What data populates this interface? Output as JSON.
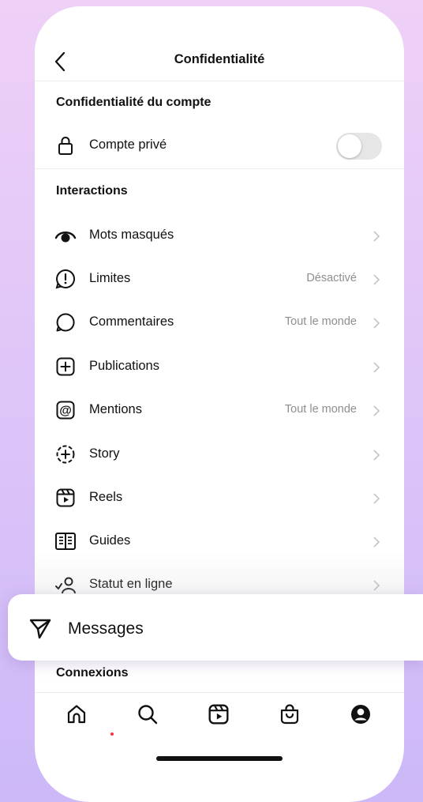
{
  "header": {
    "title": "Confidentialité"
  },
  "account_privacy": {
    "heading": "Confidentialité du compte",
    "private_account": {
      "label": "Compte privé",
      "enabled": false
    }
  },
  "interactions": {
    "heading": "Interactions",
    "items": [
      {
        "label": "Mots masqués",
        "value": "",
        "icon": "eye-icon"
      },
      {
        "label": "Limites",
        "value": "Désactivé",
        "icon": "limits-icon"
      },
      {
        "label": "Commentaires",
        "value": "Tout le monde",
        "icon": "comment-icon"
      },
      {
        "label": "Publications",
        "value": "",
        "icon": "add-post-icon"
      },
      {
        "label": "Mentions",
        "value": "Tout le monde",
        "icon": "at-icon"
      },
      {
        "label": "Story",
        "value": "",
        "icon": "story-add-icon"
      },
      {
        "label": "Reels",
        "value": "",
        "icon": "reels-icon"
      },
      {
        "label": "Guides",
        "value": "",
        "icon": "guides-icon"
      },
      {
        "label": "Statut en ligne",
        "value": "",
        "icon": "online-status-icon"
      }
    ]
  },
  "popup": {
    "label": "Messages",
    "icon": "send-icon"
  },
  "connections": {
    "heading": "Connexions"
  },
  "tabbar": {
    "items": [
      "home-icon",
      "search-icon",
      "reels-icon",
      "shop-icon",
      "profile-icon"
    ],
    "active": "home-icon",
    "accent": "#ff3040"
  }
}
